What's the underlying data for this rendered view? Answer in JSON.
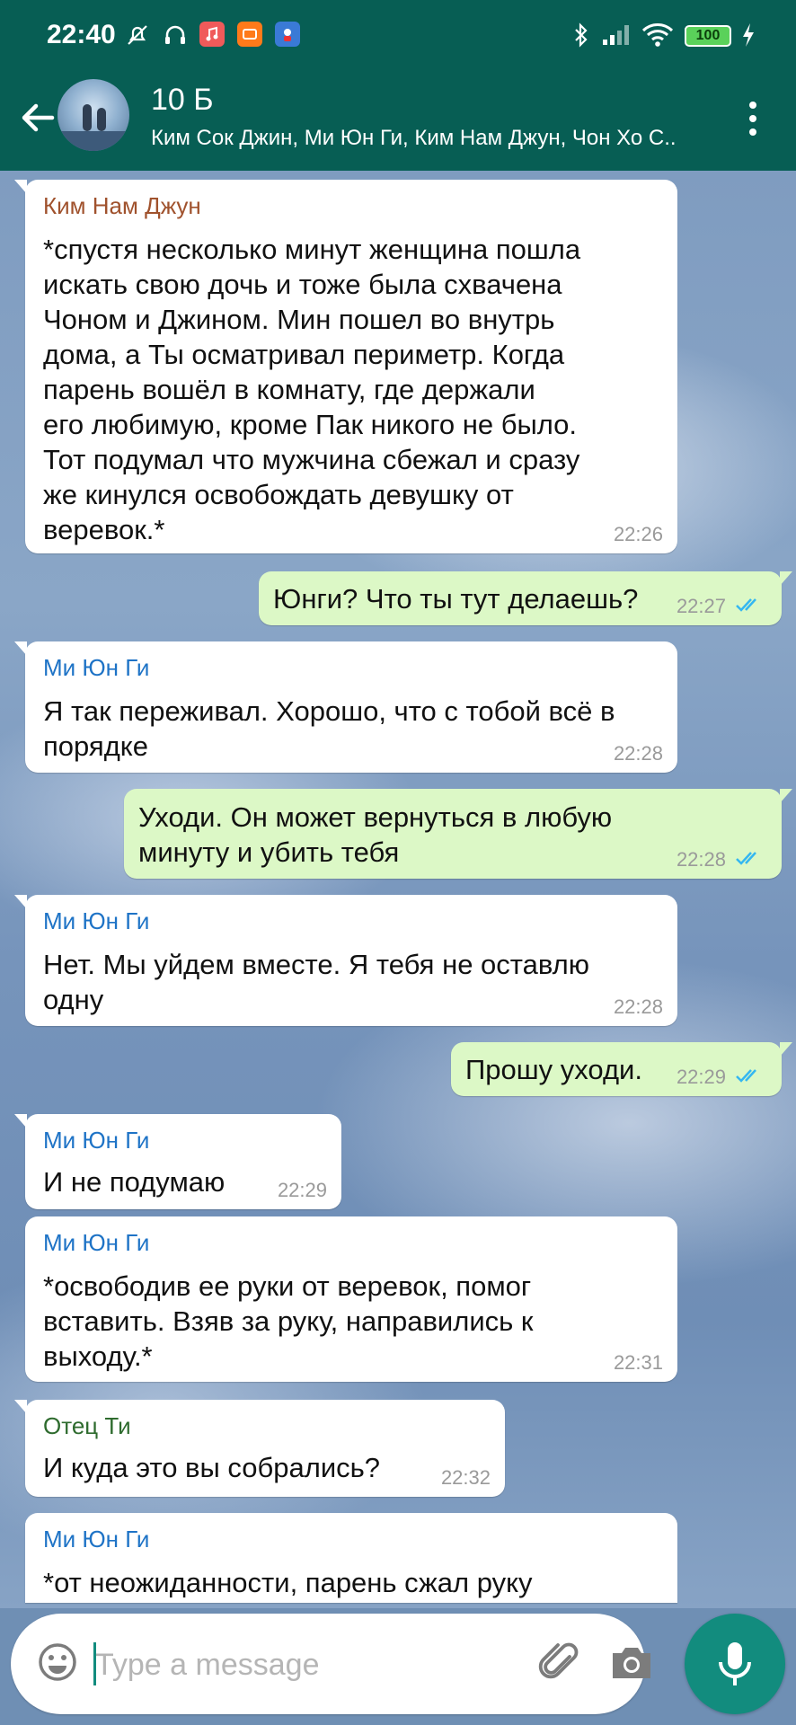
{
  "status_bar": {
    "time": "22:40",
    "battery": "100",
    "icons": [
      "dnd-off-icon",
      "headphones-icon",
      "music-app-icon",
      "mi-app-icon",
      "game-app-icon",
      "bluetooth-icon",
      "signal-icon",
      "wifi-icon",
      "charging-icon"
    ]
  },
  "chat": {
    "title": "10 Б",
    "subtitle": "Ким Сок Джин, Ми Юн Ги, Ким Нам Джун, Чон Хо С..",
    "back_icon": "arrow-left-icon",
    "menu_icon": "more-vertical-icon"
  },
  "colors": {
    "header": "#075e54",
    "accent": "#128c7e",
    "outgoing_bubble": "#dcf8c6",
    "incoming_bubble": "#ffffff",
    "read_ticks": "#34b7f1"
  },
  "messages": [
    {
      "direction": "in",
      "sender": "Ким Нам Джун",
      "sender_color": "#a0522d",
      "lines": [
        "*спустя несколько минут женщина пошла",
        "искать свою дочь и тоже была схвачена",
        "Чоном и Джином. Мин пошел во внутрь",
        "дома, а Ты осматривал периметр. Когда",
        "парень вошёл в комнату, где держали",
        "его любимую, кроме Пак никого не было.",
        "Тот подумал что мужчина сбежал и сразу",
        "же кинулся освобождать девушку от",
        "веревок.*"
      ],
      "time": "22:26"
    },
    {
      "direction": "out",
      "lines": [
        "Юнги? Что ты тут делаешь?"
      ],
      "time": "22:27",
      "status": "read"
    },
    {
      "direction": "in",
      "sender": "Ми Юн Ги",
      "sender_color": "#1e73c6",
      "lines": [
        "Я так переживал. Хорошо, что с тобой всё в",
        "порядке"
      ],
      "time": "22:28"
    },
    {
      "direction": "out",
      "lines": [
        "Уходи. Он может вернуться в любую",
        "минуту и убить тебя"
      ],
      "time": "22:28",
      "status": "read"
    },
    {
      "direction": "in",
      "sender": "Ми Юн Ги",
      "sender_color": "#1e73c6",
      "lines": [
        "Нет. Мы уйдем вместе. Я тебя не оставлю",
        "одну"
      ],
      "time": "22:28"
    },
    {
      "direction": "out",
      "lines": [
        "Прошу уходи."
      ],
      "time": "22:29",
      "status": "read"
    },
    {
      "direction": "in",
      "sender": "Ми Юн Ги",
      "sender_color": "#1e73c6",
      "lines": [
        "И не подумаю"
      ],
      "time": "22:29"
    },
    {
      "direction": "in",
      "sender": "Ми Юн Ги",
      "sender_color": "#1e73c6",
      "lines": [
        "*освободив ее руки от веревок, помог",
        "вставить. Взяв за руку, направились к",
        "выходу.*"
      ],
      "time": "22:31"
    },
    {
      "direction": "in",
      "sender": "Отец Ти",
      "sender_color": "#2e6b2e",
      "lines": [
        "И куда это вы собрались?"
      ],
      "time": "22:32"
    },
    {
      "direction": "in",
      "sender": "Ми Юн Ги",
      "sender_color": "#1e73c6",
      "lines": [
        "*от неожиданности, парень сжал руку"
      ],
      "time": ""
    }
  ],
  "composer": {
    "placeholder": "Type a message",
    "value": "",
    "emoji_icon": "emoji-icon",
    "attach_icon": "paperclip-icon",
    "camera_icon": "camera-icon",
    "mic_icon": "microphone-icon"
  }
}
